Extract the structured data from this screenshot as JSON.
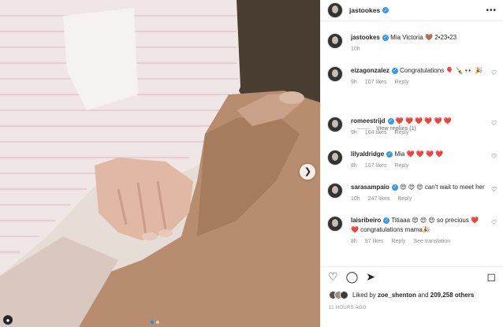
{
  "post": {
    "username": "jastookes",
    "caption": "Mia Victoria 🤎 2•23•23",
    "caption_time": "10h",
    "photo_alt_tag_icon": "user-tag-icon",
    "carousel_count": 2,
    "carousel_active": 0
  },
  "comments": [
    {
      "user": "eizagonzalez",
      "text": "Congratulations 🎈 🍾 👀 🎉",
      "time": "9h",
      "likes": "107 likes",
      "reply": "Reply"
    },
    {
      "user": "romeestrijd",
      "text": "❤️ ❤️ ❤️ ❤️ ❤️ ❤️",
      "time": "9h",
      "likes": "164 likes",
      "reply": "Reply"
    },
    {
      "user": "lilyaldridge",
      "text": "Mia ❤️ ❤️ ❤️ ❤️",
      "time": "8h",
      "likes": "107 likes",
      "reply": "Reply"
    },
    {
      "user": "sarasampaio",
      "text": "😍 😍 😍 can't wait to meet her",
      "time": "10h",
      "likes": "247 likes",
      "reply": "Reply"
    },
    {
      "user": "laisribeiro",
      "text": "Titiaaa 😍 😍 😍 so precious ❤️ ❤️ congratulations mama🎉",
      "time": "8h",
      "likes": "97 likes",
      "reply": "Reply",
      "extra": "See translation"
    }
  ],
  "view_replies": "View replies (1)",
  "liked_by": {
    "prefix": "Liked by",
    "user": "zoe_shenton",
    "mid": "and",
    "count": "209,258 others"
  },
  "timestamp": "11 HOURS AGO",
  "colors": {
    "accent": "#0095f6",
    "verified": "#3897f0",
    "heart": "#ed4956"
  }
}
